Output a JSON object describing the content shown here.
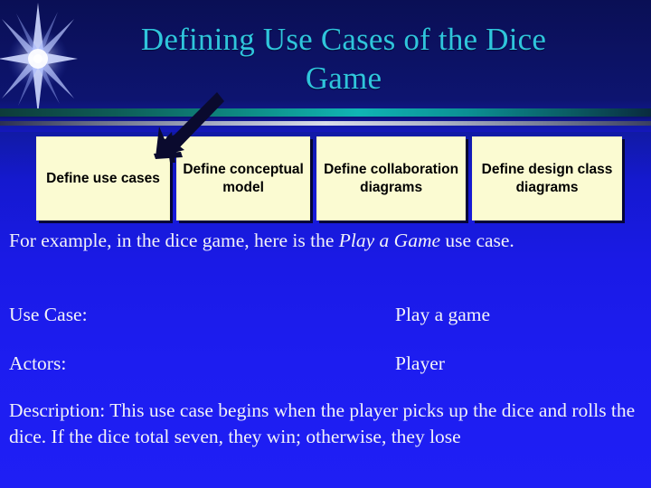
{
  "slide": {
    "title": "Defining Use Cases of the Dice Game",
    "title_line_1": "Defining Use Cases of the Dice",
    "title_line_2": "Game",
    "background_top_color": "#0a0f55",
    "background_bottom_color": "#1f1ff5",
    "title_color": "#2fc5dc",
    "body_text_color": "#f2f2f8",
    "box_fill_color": "#fbfbd2",
    "box_text_color": "#000000",
    "divider_teal_color": "#10b4b4",
    "divider_silver_color": "#d8dce9",
    "arrow_color": "#0a0a2e"
  },
  "process_boxes": [
    {
      "label": "Define use cases"
    },
    {
      "label": "Define conceptual model"
    },
    {
      "label": "Define collaboration diagrams"
    },
    {
      "label": "Define design class diagrams"
    }
  ],
  "content": {
    "intro_prefix": "For example, in the dice game, here is the ",
    "intro_emphasis": "Play a Game",
    "intro_suffix": " use case.",
    "use_case_label": "Use Case:",
    "use_case_value": "Play a game",
    "actors_label": "Actors:",
    "actors_value": "Player",
    "description": "Description: This use case begins when the player picks up the dice and rolls the dice.  If the dice total seven, they win; otherwise, they lose"
  },
  "decorations": {
    "starburst_icon": "starburst-icon",
    "arrow_icon": "arrow-down-left-icon"
  }
}
